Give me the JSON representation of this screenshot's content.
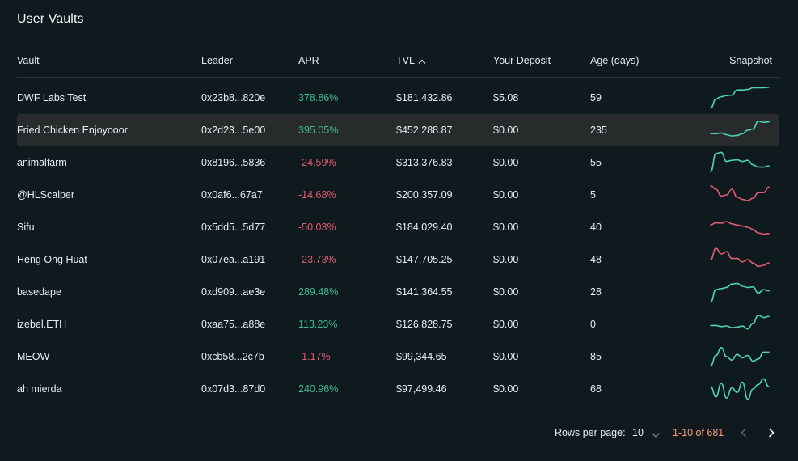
{
  "title": "User Vaults",
  "colors": {
    "positive": "#3fb88d",
    "negative": "#e35b70",
    "accent": "#f2a07e"
  },
  "columns": {
    "vault": "Vault",
    "leader": "Leader",
    "apr": "APR",
    "tvl": "TVL",
    "deposit": "Your Deposit",
    "age": "Age (days)",
    "snapshot": "Snapshot"
  },
  "sort": {
    "column": "TVL",
    "icon": "chevron-up-icon"
  },
  "rows": [
    {
      "vault": "DWF Labs Test",
      "leader": "0x23b8...820e",
      "apr": "378.86%",
      "tvl": "$181,432.86",
      "deposit": "$5.08",
      "age": "59",
      "trend": "positive",
      "snapshot": [
        0.05,
        0.45,
        0.55,
        0.6,
        0.62,
        0.85,
        0.85,
        0.87,
        0.95,
        0.95,
        0.95,
        0.97
      ]
    },
    {
      "vault": "Fried Chicken Enjoyooor",
      "leader": "0x2d23...5e00",
      "apr": "395.05%",
      "tvl": "$452,288.87",
      "deposit": "$0.00",
      "age": "235",
      "trend": "positive",
      "snapshot": [
        0.35,
        0.35,
        0.38,
        0.3,
        0.25,
        0.27,
        0.35,
        0.5,
        0.55,
        0.9,
        0.85,
        0.87
      ]
    },
    {
      "vault": "animalfarm",
      "leader": "0x8196...5836",
      "apr": "-24.59%",
      "tvl": "$313,376.83",
      "deposit": "$0.00",
      "age": "55",
      "trend": "positive",
      "snapshot": [
        0.1,
        0.9,
        0.95,
        0.55,
        0.6,
        0.62,
        0.55,
        0.6,
        0.4,
        0.3,
        0.3,
        0.35
      ]
    },
    {
      "vault": "@HLScalper",
      "leader": "0x0af6...67a7",
      "apr": "-14.68%",
      "tvl": "$200,357.09",
      "deposit": "$0.00",
      "age": "5",
      "trend": "negative",
      "snapshot": [
        0.9,
        0.75,
        0.45,
        0.5,
        0.75,
        0.4,
        0.3,
        0.25,
        0.35,
        0.6,
        0.6,
        0.85
      ]
    },
    {
      "vault": "Sifu",
      "leader": "0x5dd5...5d77",
      "apr": "-50.03%",
      "tvl": "$184,029.40",
      "deposit": "$0.00",
      "age": "40",
      "trend": "negative",
      "snapshot": [
        0.6,
        0.7,
        0.68,
        0.75,
        0.65,
        0.6,
        0.55,
        0.5,
        0.4,
        0.25,
        0.2,
        0.22
      ]
    },
    {
      "vault": "Heng Ong Huat",
      "leader": "0x07ea...a191",
      "apr": "-23.73%",
      "tvl": "$147,705.25",
      "deposit": "$0.00",
      "age": "48",
      "trend": "negative",
      "snapshot": [
        0.5,
        1.0,
        0.75,
        0.85,
        0.55,
        0.55,
        0.4,
        0.5,
        0.35,
        0.2,
        0.25,
        0.35
      ]
    },
    {
      "vault": "basedape",
      "leader": "0xd909...ae3e",
      "apr": "289.48%",
      "tvl": "$141,364.55",
      "deposit": "$0.00",
      "age": "28",
      "trend": "positive",
      "snapshot": [
        0.05,
        0.6,
        0.65,
        0.7,
        0.85,
        0.88,
        0.75,
        0.7,
        0.72,
        0.45,
        0.6,
        0.55
      ]
    },
    {
      "vault": "izebel.ETH",
      "leader": "0xaa75...a88e",
      "apr": "113.23%",
      "tvl": "$126,828.75",
      "deposit": "$0.00",
      "age": "0",
      "trend": "positive",
      "snapshot": [
        0.45,
        0.45,
        0.4,
        0.43,
        0.35,
        0.38,
        0.42,
        0.3,
        0.55,
        0.9,
        0.8,
        0.85
      ]
    },
    {
      "vault": "MEOW",
      "leader": "0xcb58...2c7b",
      "apr": "-1.17%",
      "tvl": "$99,344.65",
      "deposit": "$0.00",
      "age": "85",
      "trend": "positive",
      "snapshot": [
        0.1,
        0.55,
        0.9,
        0.5,
        0.35,
        0.6,
        0.45,
        0.55,
        0.3,
        0.4,
        0.7,
        0.7
      ]
    },
    {
      "vault": "ah mierda",
      "leader": "0x07d3...87d0",
      "apr": "240.96%",
      "tvl": "$97,499.46",
      "deposit": "$0.00",
      "age": "68",
      "trend": "positive",
      "snapshot": [
        0.6,
        0.15,
        0.75,
        0.1,
        0.55,
        0.35,
        0.8,
        0.05,
        0.5,
        0.7,
        0.95,
        0.6
      ]
    }
  ],
  "pagination": {
    "rows_per_page_label": "Rows per page:",
    "rows_per_page": "10",
    "range": "1-10 of 681",
    "prev_icon": "chevron-left-icon",
    "next_icon": "chevron-right-icon"
  }
}
